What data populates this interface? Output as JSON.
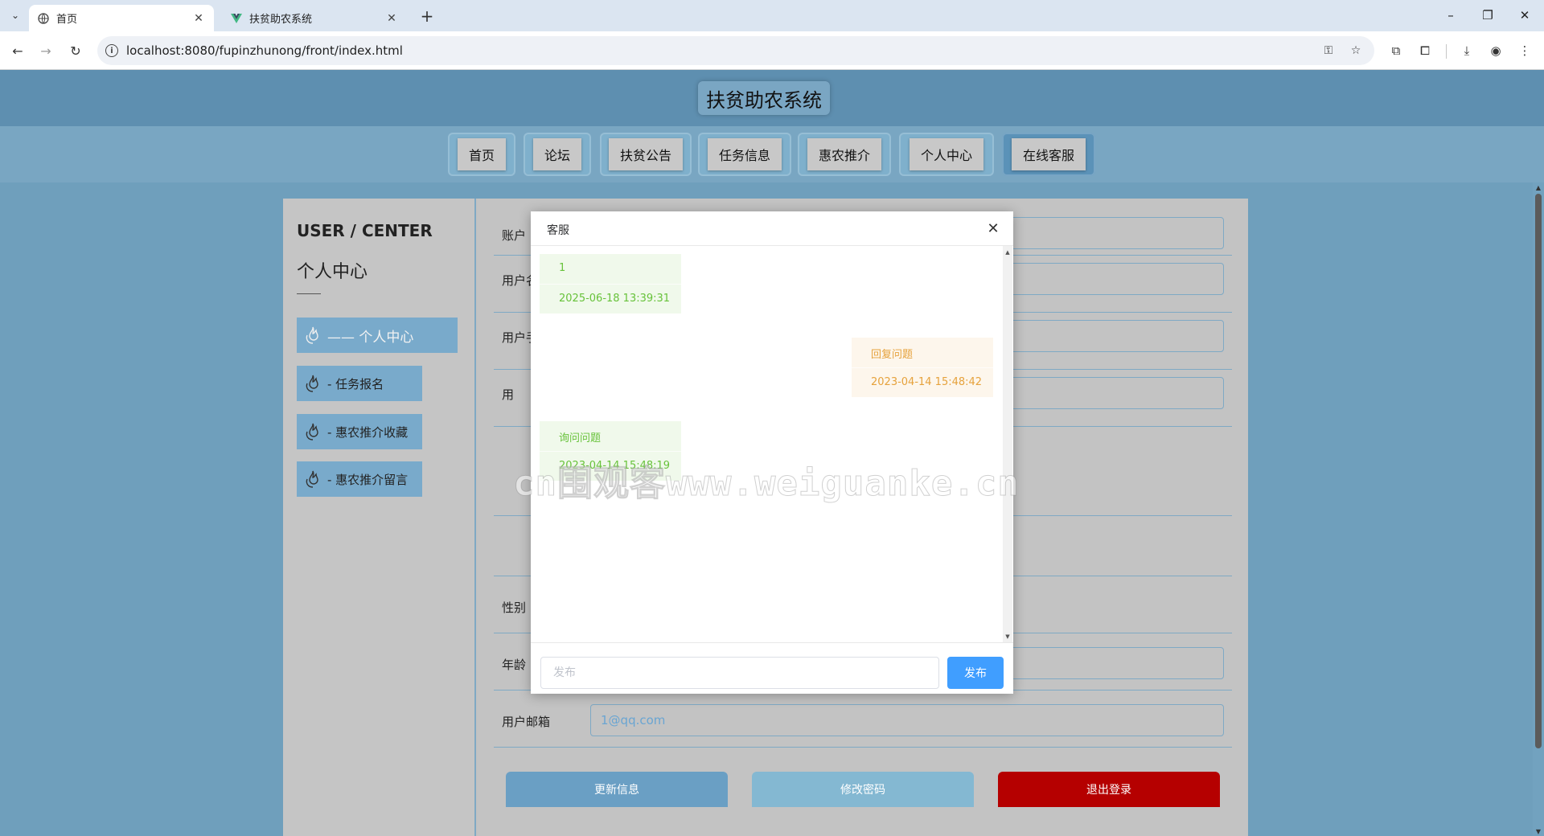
{
  "browser": {
    "tabs": [
      {
        "title": "首页",
        "icon": "globe-icon",
        "active": true
      },
      {
        "title": "扶贫助农系统",
        "icon": "vue-icon",
        "active": false
      }
    ],
    "url": "localhost:8080/fupinzhunong/front/index.html",
    "window_controls": {
      "minimize": "–",
      "restore": "❐",
      "close": "✕"
    }
  },
  "site": {
    "title": "扶贫助农系统",
    "nav": [
      "首页",
      "论坛",
      "扶贫公告",
      "任务信息",
      "惠农推介",
      "个人中心",
      "在线客服"
    ],
    "active_nav_index": 6
  },
  "sidebar": {
    "title_en": "USER / CENTER",
    "title_cn": "个人中心",
    "items": [
      {
        "label": "—— 个人中心",
        "active": true
      },
      {
        "label": "-  任务报名",
        "active": false
      },
      {
        "label": "-  惠农推介收藏",
        "active": false
      },
      {
        "label": "-  惠农推介留言",
        "active": false
      }
    ]
  },
  "form": {
    "labels": {
      "account": "账户",
      "username": "用户名",
      "phone": "用户手",
      "idcard": "用 ",
      "gender": "性别",
      "age": "年龄",
      "email": "用户邮箱"
    },
    "email_value": "1@qq.com",
    "buttons": {
      "update": "更新信息",
      "password": "修改密码",
      "logout": "退出登录"
    },
    "colors": {
      "update": "#6a9fc4",
      "password": "#84b8d2",
      "logout": "#b50000"
    }
  },
  "dialog": {
    "title": "客服",
    "messages": [
      {
        "role": "user",
        "text": "1",
        "time": "2025-06-18 13:39:31"
      },
      {
        "role": "admin",
        "text": "回复问题",
        "time": "2023-04-14 15:48:42"
      },
      {
        "role": "user",
        "text": "询问问题",
        "time": "2023-04-14 15:48:19"
      }
    ],
    "input_placeholder": "发布",
    "send_label": "发布",
    "accent": "#409eff"
  },
  "watermark": "cn围观客www.weiguanke.cn"
}
